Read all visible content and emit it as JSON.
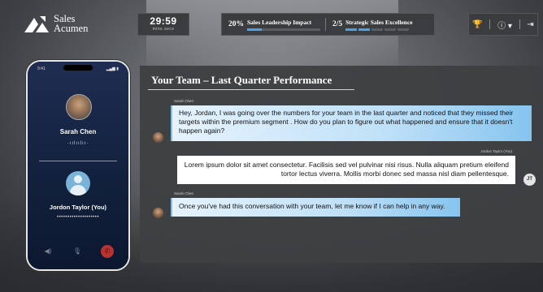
{
  "header": {
    "brand_line1": "Sales",
    "brand_line2": "Acumen",
    "timer_value": "29:59",
    "timer_label": "mins  secs",
    "progress1_value": "20%",
    "progress1_title": "Sales Leadership Impact",
    "progress1_fraction": 0.2,
    "progress2_value": "2/5",
    "progress2_title": "Strategic Sales Excellence",
    "progress2_done": 2,
    "progress2_total": 5,
    "tools": [
      {
        "icon": "trophy-icon",
        "glyph": "🏆"
      },
      {
        "icon": "info-icon",
        "glyph": "ⓘ ▾"
      },
      {
        "icon": "exit-icon",
        "glyph": "⇥"
      }
    ]
  },
  "phone": {
    "status_time": "9:41",
    "status_icons": "▂▄▆ ▮",
    "caller_name": "Sarah Chen",
    "waveform": "·ıılıılıı·",
    "user_name": "Jordon Taylor (You)",
    "dots": "••••••••••••••••••••"
  },
  "chat": {
    "title": "Your Team – Last Quarter Performance",
    "messages": [
      {
        "sender": "Sarah Chen",
        "role": "coach",
        "text": "Hey, Jordan, I was going over the numbers for your team in the last quarter and noticed that they missed their targets within the premium segment . How do you plan to figure out what happened and ensure that it doesn't happen again?"
      },
      {
        "sender": "Jordon Taylor (You)",
        "role": "user",
        "initials": "JT",
        "text": "Lorem ipsum dolor sit amet consectetur. Facilisis sed vel pulvinar nisi risus. Nulla aliquam pretium eleifend tortor lectus viverra. Mollis morbi donec sed massa nisl diam pellentesque."
      },
      {
        "sender": "Sarah Chen",
        "role": "coach",
        "text": "Once you've had this conversation with your team, let me know if I can help in any way."
      }
    ]
  },
  "colors": {
    "accent": "#4aa3e8",
    "end_call": "#b8322f",
    "panel": "#3e3f42"
  }
}
